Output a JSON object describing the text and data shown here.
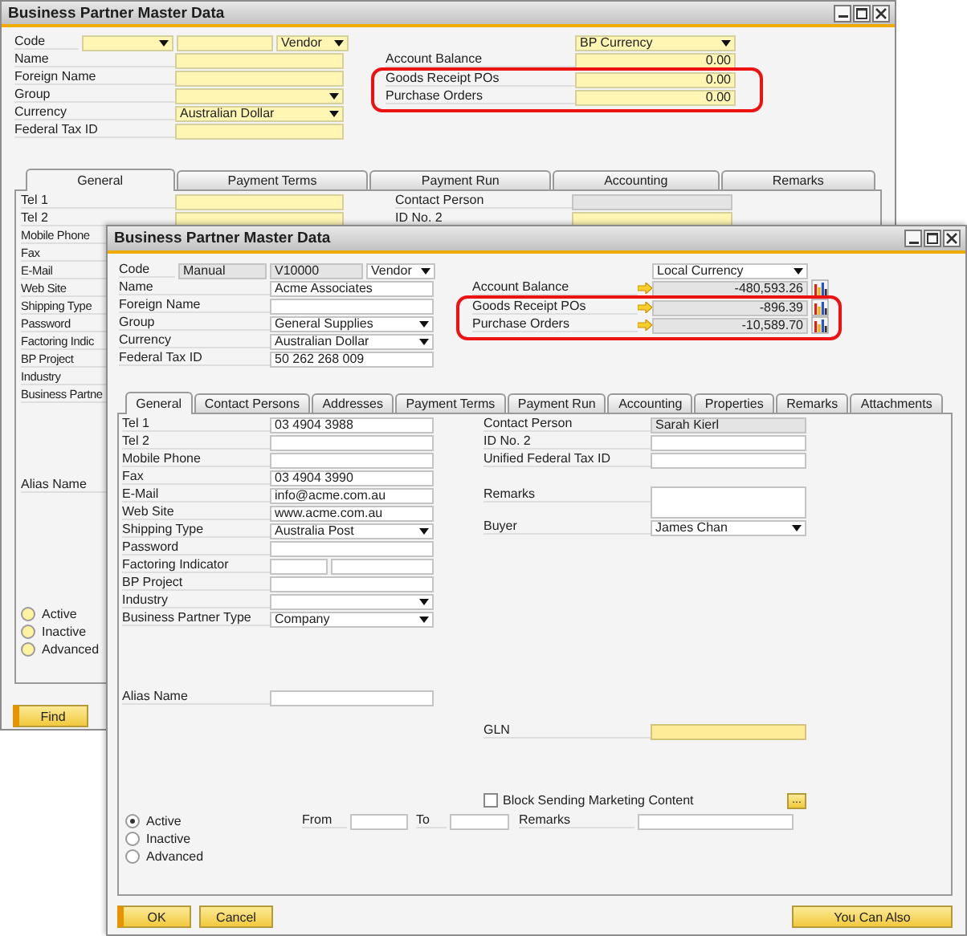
{
  "back_window": {
    "title": "Business Partner Master Data",
    "find_mode": true,
    "code": {
      "label": "Code",
      "type": "Vendor",
      "editable": true
    },
    "header_fields": [
      {
        "label": "Name",
        "kind": "text"
      },
      {
        "label": "Foreign Name",
        "kind": "text"
      },
      {
        "label": "Group",
        "kind": "select"
      },
      {
        "label": "Currency",
        "kind": "select",
        "value": "Australian Dollar"
      },
      {
        "label": "Federal Tax ID",
        "kind": "text"
      }
    ],
    "currency_view": "BP Currency",
    "balances": [
      {
        "label": "Account Balance",
        "value": "0.00",
        "highlighted": false
      },
      {
        "label": "Goods Receipt POs",
        "value": "0.00",
        "highlighted": true
      },
      {
        "label": "Purchase Orders",
        "value": "0.00",
        "highlighted": true
      }
    ],
    "tabs": [
      {
        "label": "General",
        "selected": true
      },
      {
        "label": "Payment Terms",
        "selected": false
      },
      {
        "label": "Payment Run",
        "selected": false
      },
      {
        "label": "Accounting",
        "selected": false
      },
      {
        "label": "Remarks",
        "selected": false
      }
    ],
    "general_left": [
      {
        "label": "Tel 1",
        "kind": "text"
      },
      {
        "label": "Tel 2",
        "kind": "text"
      },
      {
        "label": "Mobile Phone",
        "kind": "label"
      },
      {
        "label": "Fax",
        "kind": "label"
      },
      {
        "label": "E-Mail",
        "kind": "label"
      },
      {
        "label": "Web Site",
        "kind": "label"
      },
      {
        "label": "Shipping Type",
        "kind": "label"
      },
      {
        "label": "Password",
        "kind": "label"
      },
      {
        "label": "Factoring Indic",
        "kind": "label"
      },
      {
        "label": "BP Project",
        "kind": "label"
      },
      {
        "label": "Industry",
        "kind": "label"
      },
      {
        "label": "Business Partne",
        "kind": "label"
      }
    ],
    "general_right": [
      {
        "label": "Contact Person",
        "kind": "text",
        "readonly": true
      },
      {
        "label": "ID No. 2",
        "kind": "text",
        "readonly": false
      }
    ],
    "alias": {
      "label": "Alias Name"
    },
    "statuses": [
      {
        "label": "Active",
        "selected": false
      },
      {
        "label": "Inactive",
        "selected": false
      },
      {
        "label": "Advanced",
        "selected": false
      }
    ],
    "buttons": [
      {
        "label": "Find",
        "kind": "primary"
      }
    ]
  },
  "front_window": {
    "title": "Business Partner Master Data",
    "find_mode": false,
    "code": {
      "label": "Code",
      "series": "Manual",
      "number": "V10000",
      "type": "Vendor",
      "editable": false
    },
    "header_fields": [
      {
        "label": "Name",
        "kind": "text",
        "value": "Acme Associates"
      },
      {
        "label": "Foreign Name",
        "kind": "text"
      },
      {
        "label": "Group",
        "kind": "select",
        "value": "General Supplies"
      },
      {
        "label": "Currency",
        "kind": "select",
        "value": "Australian Dollar"
      },
      {
        "label": "Federal Tax ID",
        "kind": "text",
        "value": "50 262 268 009"
      }
    ],
    "currency_view": "Local Currency",
    "balances": [
      {
        "label": "Account Balance",
        "value": "-480,593.26",
        "highlighted": false
      },
      {
        "label": "Goods Receipt POs",
        "value": "-896.39",
        "highlighted": true
      },
      {
        "label": "Purchase Orders",
        "value": "-10,589.70",
        "highlighted": true
      }
    ],
    "tabs": [
      {
        "label": "General",
        "selected": true
      },
      {
        "label": "Contact Persons",
        "selected": false
      },
      {
        "label": "Addresses",
        "selected": false
      },
      {
        "label": "Payment Terms",
        "selected": false
      },
      {
        "label": "Payment Run",
        "selected": false
      },
      {
        "label": "Accounting",
        "selected": false
      },
      {
        "label": "Properties",
        "selected": false
      },
      {
        "label": "Remarks",
        "selected": false
      },
      {
        "label": "Attachments",
        "selected": false
      }
    ],
    "general_left": [
      {
        "label": "Tel 1",
        "kind": "text",
        "value": "03 4904 3988"
      },
      {
        "label": "Tel 2",
        "kind": "text"
      },
      {
        "label": "Mobile Phone",
        "kind": "text"
      },
      {
        "label": "Fax",
        "kind": "text",
        "value": "03 4904 3990"
      },
      {
        "label": "E-Mail",
        "kind": "text",
        "value": "info@acme.com.au"
      },
      {
        "label": "Web Site",
        "kind": "text",
        "value": "www.acme.com.au"
      },
      {
        "label": "Shipping Type",
        "kind": "select",
        "value": "Australia Post"
      },
      {
        "label": "Password",
        "kind": "text"
      },
      {
        "label": "Factoring Indicator",
        "kind": "split"
      },
      {
        "label": "BP Project",
        "kind": "text"
      },
      {
        "label": "Industry",
        "kind": "select"
      },
      {
        "label": "Business Partner Type",
        "kind": "select",
        "value": "Company"
      }
    ],
    "general_right": [
      {
        "label": "Contact Person",
        "kind": "text",
        "value": "Sarah Kierl",
        "readonly": true
      },
      {
        "label": "ID No. 2",
        "kind": "text",
        "readonly": false
      },
      {
        "label": "Unified Federal Tax ID",
        "kind": "text",
        "readonly": false
      },
      {
        "label": "Remarks",
        "kind": "textarea",
        "readonly": false
      },
      {
        "label": "Buyer",
        "kind": "select",
        "value": "James Chan",
        "readonly": false
      }
    ],
    "alias": {
      "label": "Alias Name"
    },
    "gln": {
      "label": "GLN"
    },
    "marketing": {
      "label": "Block Sending Marketing Content",
      "checked": false
    },
    "more_button": "...",
    "period": {
      "from": "From",
      "to": "To",
      "remarks": "Remarks"
    },
    "statuses": [
      {
        "label": "Active",
        "selected": true
      },
      {
        "label": "Inactive",
        "selected": false
      },
      {
        "label": "Advanced",
        "selected": false
      }
    ],
    "buttons": [
      {
        "label": "OK",
        "kind": "primary"
      },
      {
        "label": "Cancel",
        "kind": "secondary"
      }
    ],
    "you_can_also": "You Can Also"
  }
}
